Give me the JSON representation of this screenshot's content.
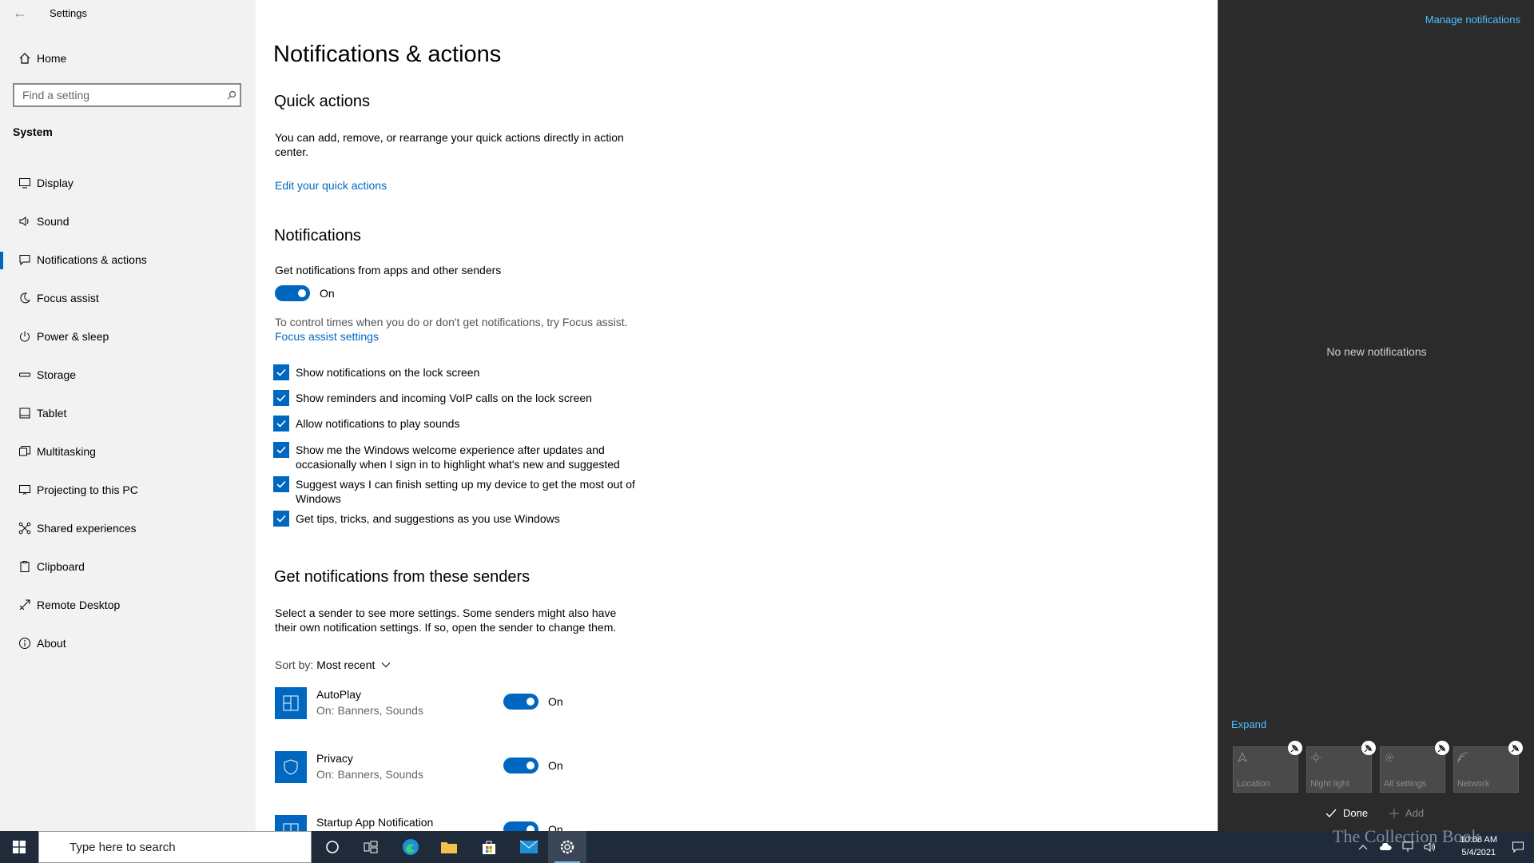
{
  "window": {
    "title": "Settings"
  },
  "sidebar": {
    "home": "Home",
    "search_placeholder": "Find a setting",
    "section": "System",
    "items": [
      {
        "label": "Display",
        "icon": "monitor-icon"
      },
      {
        "label": "Sound",
        "icon": "speaker-icon"
      },
      {
        "label": "Notifications & actions",
        "icon": "notification-icon",
        "active": true
      },
      {
        "label": "Focus assist",
        "icon": "moon-icon"
      },
      {
        "label": "Power & sleep",
        "icon": "power-icon"
      },
      {
        "label": "Storage",
        "icon": "storage-icon"
      },
      {
        "label": "Tablet",
        "icon": "tablet-icon"
      },
      {
        "label": "Multitasking",
        "icon": "multitasking-icon"
      },
      {
        "label": "Projecting to this PC",
        "icon": "projecting-icon"
      },
      {
        "label": "Shared experiences",
        "icon": "shared-icon"
      },
      {
        "label": "Clipboard",
        "icon": "clipboard-icon"
      },
      {
        "label": "Remote Desktop",
        "icon": "remote-desktop-icon"
      },
      {
        "label": "About",
        "icon": "info-icon"
      }
    ]
  },
  "main": {
    "title": "Notifications & actions",
    "quick_actions": {
      "heading": "Quick actions",
      "text": "You can add, remove, or rearrange your quick actions directly in action center.",
      "link": "Edit your quick actions"
    },
    "notifications": {
      "heading": "Notifications",
      "get_label": "Get notifications from apps and other senders",
      "toggle_state": "On",
      "focus_text": "To control times when you do or don't get notifications, try Focus assist.",
      "focus_link": "Focus assist settings",
      "checkboxes": [
        "Show notifications on the lock screen",
        "Show reminders and incoming VoIP calls on the lock screen",
        "Allow notifications to play sounds",
        "Show me the Windows welcome experience after updates and occasionally when I sign in to highlight what's new and suggested",
        "Suggest ways I can finish setting up my device to get the most out of Windows",
        "Get tips, tricks, and suggestions as you use Windows"
      ]
    },
    "senders": {
      "heading": "Get notifications from these senders",
      "text": "Select a sender to see more settings. Some senders might also have their own notification settings. If so, open the sender to change them.",
      "sort_label": "Sort by:",
      "sort_value": "Most recent",
      "list": [
        {
          "name": "AutoPlay",
          "sub": "On: Banners, Sounds",
          "state": "On"
        },
        {
          "name": "Privacy",
          "sub": "On: Banners, Sounds",
          "state": "On"
        },
        {
          "name": "Startup App Notification",
          "sub": "",
          "state": "On"
        }
      ]
    }
  },
  "action_center": {
    "manage": "Manage notifications",
    "empty": "No new notifications",
    "expand": "Expand",
    "tiles": [
      "Location",
      "Night light",
      "All settings",
      "Network"
    ],
    "done": "Done",
    "add": "Add"
  },
  "taskbar": {
    "search_placeholder": "Type here to search",
    "time": "10:08 AM",
    "date": "5/4/2021",
    "watermark": "The Collection Book"
  },
  "colors": {
    "accent": "#0067c0",
    "action_center_bg": "#2b2b2b",
    "taskbar_bg": "#1f2a3a",
    "link_dark": "#4cc2ff"
  }
}
